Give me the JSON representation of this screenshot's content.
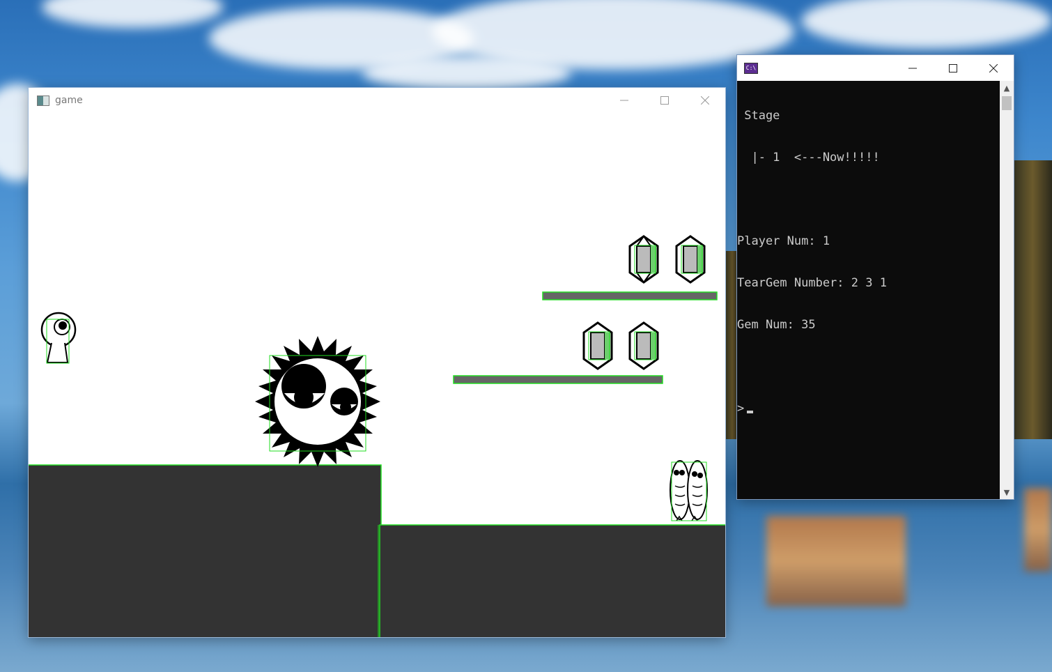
{
  "game_window": {
    "title": "game",
    "icon": "app-window-icon",
    "controls": [
      "minimize-icon",
      "maximize-icon",
      "close-icon"
    ]
  },
  "console_window": {
    "icon": "cmd-icon",
    "icon_label": "C:\\",
    "controls": [
      "minimize-icon",
      "maximize-icon",
      "close-icon"
    ],
    "lines": [
      " Stage",
      "  |- 1  <---Now!!!!!",
      "",
      "Player Num: 1",
      "TearGem Number: 2 3 1",
      "Gem Num: 35",
      "",
      ">"
    ]
  },
  "colors": {
    "ground": "#333333",
    "platform": "#666666",
    "hitbox": "#22dd22",
    "console_bg": "#0c0c0c",
    "console_text": "#cccccc"
  }
}
